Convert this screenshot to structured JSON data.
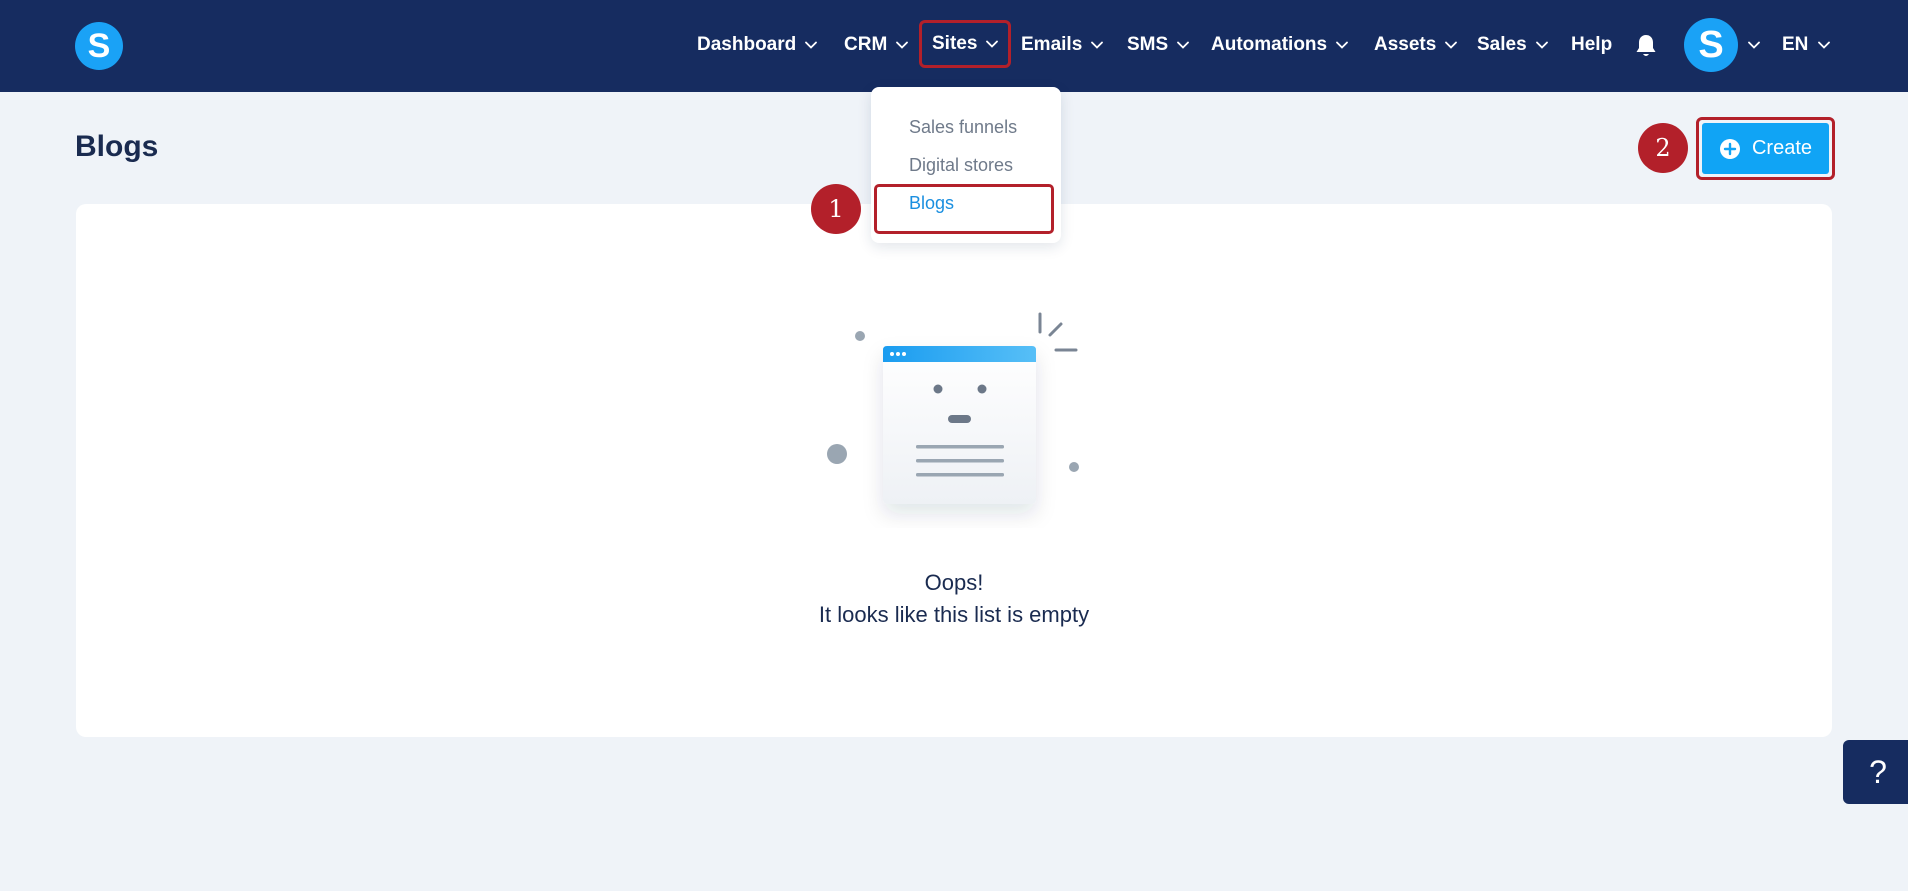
{
  "brand": {
    "logo_letter": "S"
  },
  "nav": {
    "items": [
      {
        "label": "Dashboard"
      },
      {
        "label": "CRM"
      },
      {
        "label": "Sites"
      },
      {
        "label": "Emails"
      },
      {
        "label": "SMS"
      },
      {
        "label": "Automations"
      },
      {
        "label": "Assets"
      },
      {
        "label": "Sales"
      }
    ],
    "help": "Help",
    "avatar_letter": "S",
    "language": "EN"
  },
  "dropdown": {
    "items": [
      {
        "label": "Sales funnels"
      },
      {
        "label": "Digital stores"
      },
      {
        "label": "Blogs"
      }
    ]
  },
  "annotations": {
    "step1": "1",
    "step2": "2"
  },
  "page": {
    "title": "Blogs",
    "create_label": "Create",
    "empty_title": "Oops!",
    "empty_subtitle": "It looks like this list is empty"
  },
  "help_button": {
    "label": "?"
  },
  "colors": {
    "nav_bg": "#162c60",
    "accent": "#10a4f5",
    "annotation": "#b3202a",
    "page_bg": "#eff3f8"
  }
}
